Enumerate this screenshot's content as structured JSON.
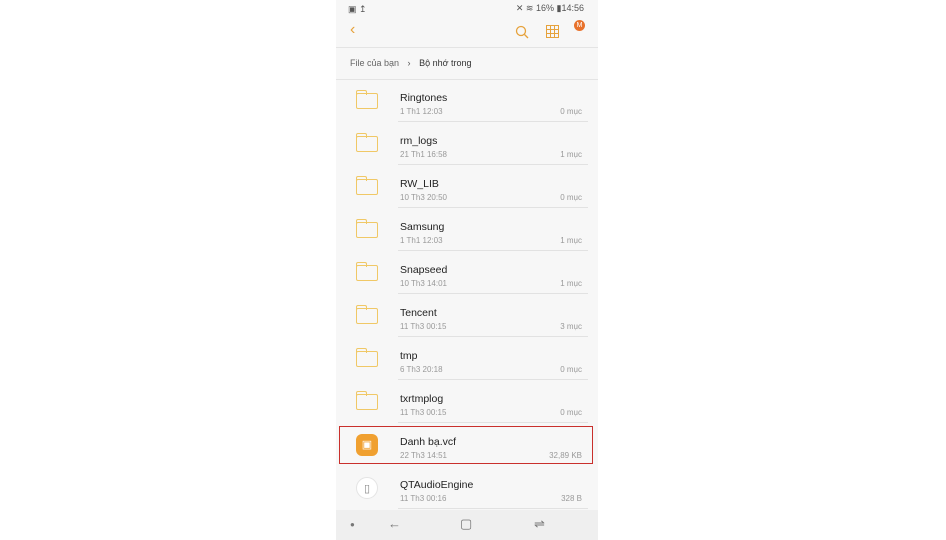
{
  "status": {
    "left_icons": [
      "image-icon",
      "upload-icon"
    ],
    "right_icons": [
      "mute-icon",
      "wifi-icon",
      "battery-icon"
    ],
    "battery": "16%",
    "time": "14:56"
  },
  "toolbar": {
    "badge": "M",
    "icons": [
      "back-icon",
      "search-icon",
      "grid-view-icon",
      "notification-icon"
    ]
  },
  "breadcrumb": {
    "root": "File của bạn",
    "current": "Bộ nhớ trong"
  },
  "colors": {
    "accent": "#e6a23c",
    "highlight": "#c9302c"
  },
  "items": [
    {
      "name": "Ringtones",
      "date": "1 Th1 12:03",
      "size": "0 mục",
      "type": "folder"
    },
    {
      "name": "rm_logs",
      "date": "21 Th1 16:58",
      "size": "1 mục",
      "type": "folder"
    },
    {
      "name": "RW_LIB",
      "date": "10 Th3 20:50",
      "size": "0 mục",
      "type": "folder"
    },
    {
      "name": "Samsung",
      "date": "1 Th1 12:03",
      "size": "1 mục",
      "type": "folder"
    },
    {
      "name": "Snapseed",
      "date": "10 Th3 14:01",
      "size": "1 mục",
      "type": "folder"
    },
    {
      "name": "Tencent",
      "date": "11 Th3 00:15",
      "size": "3 mục",
      "type": "folder"
    },
    {
      "name": "tmp",
      "date": "6 Th3 20:18",
      "size": "0 mục",
      "type": "folder"
    },
    {
      "name": "txrtmplog",
      "date": "11 Th3 00:15",
      "size": "0 mục",
      "type": "folder"
    },
    {
      "name": "Danh bạ.vcf",
      "date": "22 Th3 14:51",
      "size": "32,89 KB",
      "type": "vcf",
      "highlighted": true
    },
    {
      "name": "QTAudioEngine",
      "date": "11 Th3 00:16",
      "size": "328 B",
      "type": "file"
    }
  ]
}
